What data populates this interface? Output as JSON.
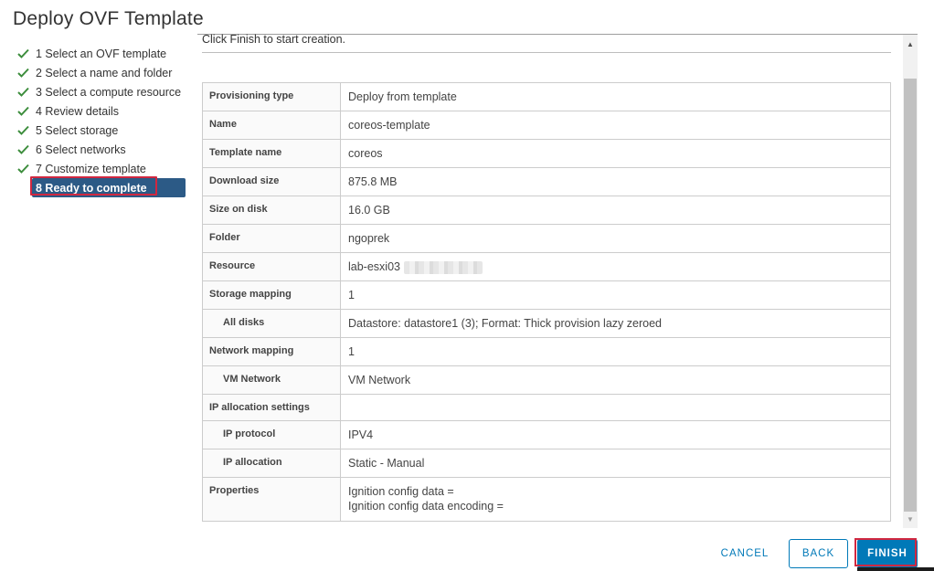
{
  "dialog": {
    "title": "Deploy OVF Template"
  },
  "steps": [
    {
      "label": "1 Select an OVF template",
      "completed": true
    },
    {
      "label": "2 Select a name and folder",
      "completed": true
    },
    {
      "label": "3 Select a compute resource",
      "completed": true
    },
    {
      "label": "4 Review details",
      "completed": true
    },
    {
      "label": "5 Select storage",
      "completed": true
    },
    {
      "label": "6 Select networks",
      "completed": true
    },
    {
      "label": "7 Customize template",
      "completed": true
    },
    {
      "label": "8 Ready to complete",
      "completed": false,
      "active": true
    }
  ],
  "content": {
    "intro": "Click Finish to start creation."
  },
  "summary": {
    "provisioning_type": {
      "label": "Provisioning type",
      "value": "Deploy from template"
    },
    "name": {
      "label": "Name",
      "value": "coreos-template"
    },
    "template_name": {
      "label": "Template name",
      "value": "coreos"
    },
    "download_size": {
      "label": "Download size",
      "value": "875.8 MB"
    },
    "size_on_disk": {
      "label": "Size on disk",
      "value": "16.0 GB"
    },
    "folder": {
      "label": "Folder",
      "value": "ngoprek"
    },
    "resource": {
      "label": "Resource",
      "value": "lab-esxi03"
    },
    "storage_mapping": {
      "label": "Storage mapping",
      "value": "1"
    },
    "all_disks": {
      "label": "All disks",
      "value": "Datastore: datastore1 (3); Format: Thick provision lazy zeroed"
    },
    "network_mapping": {
      "label": "Network mapping",
      "value": "1"
    },
    "vm_network": {
      "label": "VM Network",
      "value": "VM Network"
    },
    "ip_allocation_settings": {
      "label": "IP allocation settings",
      "value": ""
    },
    "ip_protocol": {
      "label": "IP protocol",
      "value": "IPV4"
    },
    "ip_allocation": {
      "label": "IP allocation",
      "value": "Static - Manual"
    },
    "properties": {
      "label": "Properties",
      "line1": "Ignition config data =",
      "line2": "Ignition config data encoding ="
    }
  },
  "footer": {
    "cancel_label": "CANCEL",
    "back_label": "BACK",
    "finish_label": "FINISH"
  },
  "colors": {
    "active_step_bg": "#2c5a86",
    "check": "#3c8d3c",
    "primary": "#0079b8",
    "highlight_outline": "#d02740"
  },
  "icons": {
    "step_done": "checkmark-icon",
    "scroll_up": "scroll-up-arrow-icon",
    "scroll_down": "scroll-down-arrow-icon"
  }
}
